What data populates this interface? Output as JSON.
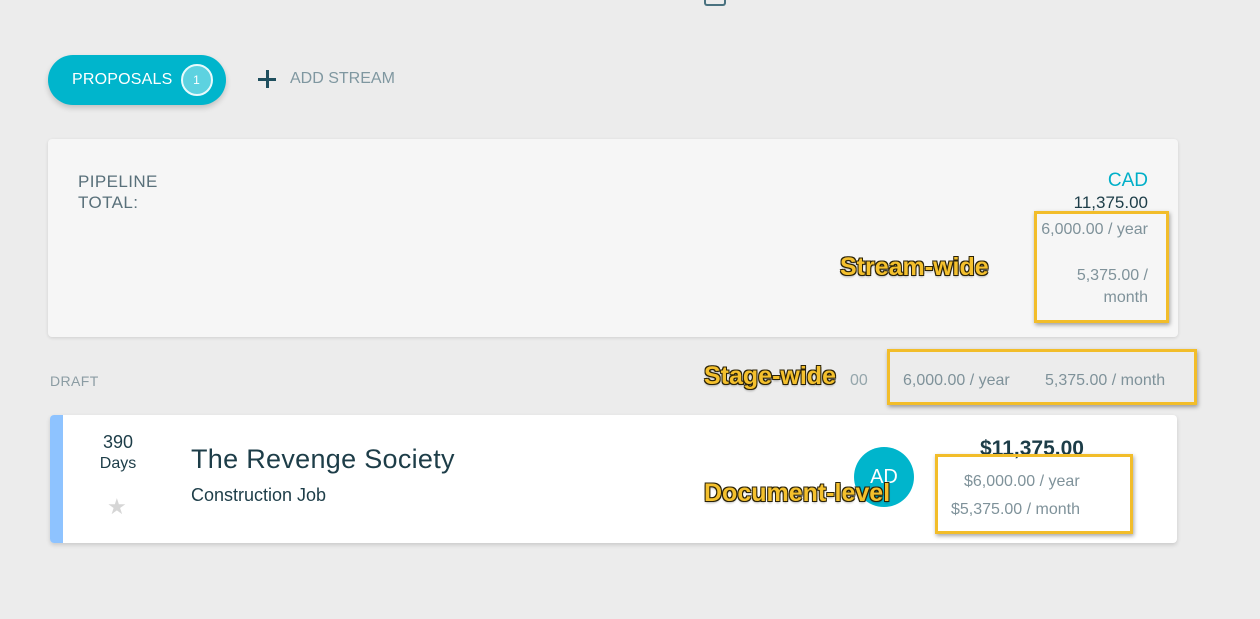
{
  "toolbar": {
    "proposals_label": "PROPOSALS",
    "proposals_count": "1",
    "add_stream_label": "ADD STREAM"
  },
  "pipeline": {
    "label": "PIPELINE TOTAL:",
    "currency": "CAD",
    "total": "11,375.00",
    "yearly": "6,000.00 / year",
    "monthly": "5,375.00 / month"
  },
  "stage": {
    "name": "DRAFT",
    "total_partial": "00",
    "yearly": "6,000.00 / year",
    "monthly": "5,375.00 / month"
  },
  "document": {
    "days_number": "390",
    "days_label": "Days",
    "title": "The Revenge Society",
    "subtitle": "Construction Job",
    "avatar_initials": "AD",
    "total": "$11,375.00",
    "yearly": "$6,000.00 / year",
    "monthly": "$5,375.00 / month"
  },
  "annotations": {
    "stream": "Stream-wide",
    "stage": "Stage-wide",
    "document": "Document-level"
  },
  "colors": {
    "accent": "#00b5cc",
    "highlight": "#f2bd2a",
    "card_accent": "#8ec3ff",
    "text_dark": "#1d3d48"
  }
}
